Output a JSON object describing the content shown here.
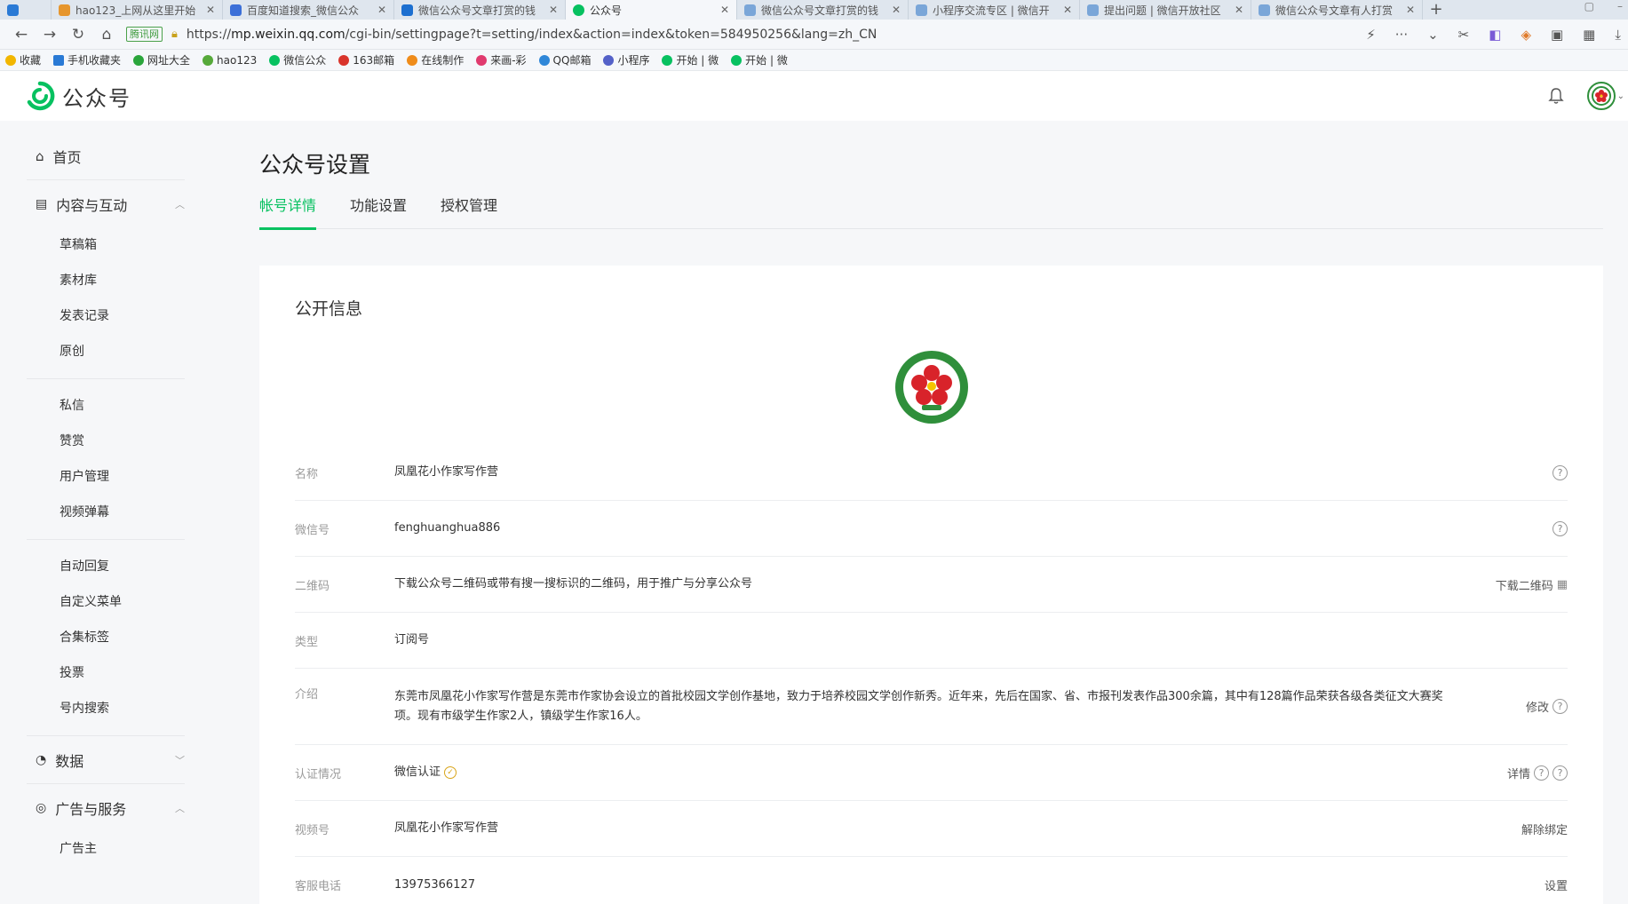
{
  "browser": {
    "tabs": [
      {
        "label": "hao123_上网从这里开始",
        "color": "#e6962e",
        "active": false
      },
      {
        "label": "百度知道搜索_微信公众",
        "color": "#3b6fd8",
        "active": false
      },
      {
        "label": "微信公众号文章打赏的钱",
        "color": "#1c6fd0",
        "active": false
      },
      {
        "label": "公众号",
        "color": "#07c160",
        "active": true
      },
      {
        "label": "微信公众号文章打赏的钱",
        "color": "#7aa6d8",
        "active": false
      },
      {
        "label": "小程序交流专区 | 微信开",
        "color": "#7aa6d8",
        "active": false
      },
      {
        "label": "提出问题 | 微信开放社区",
        "color": "#7aa6d8",
        "active": false
      },
      {
        "label": "微信公众号文章有人打赏",
        "color": "#7aa6d8",
        "active": false
      }
    ],
    "new_tab": "+",
    "secure_badge": "腾讯网",
    "url_prefix": "https://",
    "url_host": "mp.weixin.qq.com",
    "url_path": "/cgi-bin/settingpage?t=setting/index&action=index&token=584950256&lang=zh_CN",
    "bookmarks": [
      {
        "label": "收藏",
        "color": "#f2b600"
      },
      {
        "label": "手机收藏夹",
        "color": "#2a7ad5"
      },
      {
        "label": "网址大全",
        "color": "#2aa53b"
      },
      {
        "label": "hao123",
        "color": "#56a93a"
      },
      {
        "label": "微信公众",
        "color": "#07c160"
      },
      {
        "label": "163邮箱",
        "color": "#d9342b"
      },
      {
        "label": "在线制作",
        "color": "#ef8c1a"
      },
      {
        "label": "来画-彩",
        "color": "#e03a6e"
      },
      {
        "label": "QQ邮箱",
        "color": "#2f87d8"
      },
      {
        "label": "小程序",
        "color": "#5461c8"
      },
      {
        "label": "开始 | 微",
        "color": "#07c160"
      },
      {
        "label": "开始 | 微",
        "color": "#07c160"
      }
    ]
  },
  "header": {
    "brand": "公众号"
  },
  "sidebar": {
    "home": "首页",
    "content_group": "内容与互动",
    "content_items_a": [
      "草稿箱",
      "素材库",
      "发表记录",
      "原创"
    ],
    "content_items_b": [
      "私信",
      "赞赏",
      "用户管理",
      "视频弹幕"
    ],
    "content_items_c": [
      "自动回复",
      "自定义菜单",
      "合集标签",
      "投票",
      "号内搜索"
    ],
    "data_group": "数据",
    "ads_group": "广告与服务",
    "ads_items": [
      "广告主"
    ]
  },
  "page": {
    "title": "公众号设置",
    "tabs": [
      "帐号详情",
      "功能设置",
      "授权管理"
    ],
    "section_title": "公开信息",
    "rows": {
      "name": {
        "label": "名称",
        "value": "凤凰花小作家写作营"
      },
      "wechat_id": {
        "label": "微信号",
        "value": "fenghuanghua886"
      },
      "qrcode": {
        "label": "二维码",
        "value": "下载公众号二维码或带有搜一搜标识的二维码，用于推广与分享公众号",
        "action": "下载二维码"
      },
      "type": {
        "label": "类型",
        "value": "订阅号"
      },
      "intro": {
        "label": "介绍",
        "value": "东莞市凤凰花小作家写作营是东莞市作家协会设立的首批校园文学创作基地，致力于培养校园文学创作新秀。近年来，先后在国家、省、市报刊发表作品300余篇，其中有128篇作品荣获各级各类征文大赛奖项。现有市级学生作家2人，镇级学生作家16人。",
        "action": "修改"
      },
      "verify": {
        "label": "认证情况",
        "value": "微信认证",
        "action": "详情"
      },
      "channels": {
        "label": "视频号",
        "value": "凤凰花小作家写作营",
        "action": "解除绑定"
      },
      "phone": {
        "label": "客服电话",
        "value": "13975366127",
        "action": "设置"
      }
    },
    "help_glyph": "?"
  }
}
